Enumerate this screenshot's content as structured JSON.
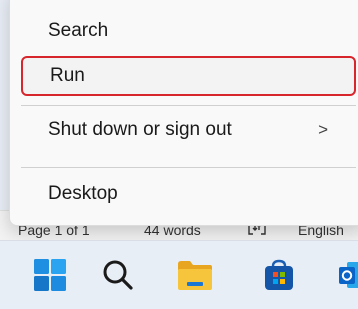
{
  "menu": {
    "items": [
      {
        "label": "Search"
      },
      {
        "label": "Run",
        "highlighted": true
      },
      {
        "label": "Shut down or sign out",
        "submenu_arrow": ">"
      },
      {
        "label": "Desktop"
      }
    ]
  },
  "statusbar": {
    "page": "Page 1 of 1",
    "words": "44 words",
    "proofing_icon": "proofing-icon",
    "language": "English"
  },
  "taskbar": {
    "icons": [
      "windows-start-icon",
      "search-icon",
      "file-explorer-icon",
      "microsoft-store-icon",
      "outlook-icon"
    ]
  },
  "colors": {
    "highlight_border": "#d8262d",
    "menu_bg": "#f9f9f9",
    "taskbar_bg": "#e8eef6"
  }
}
